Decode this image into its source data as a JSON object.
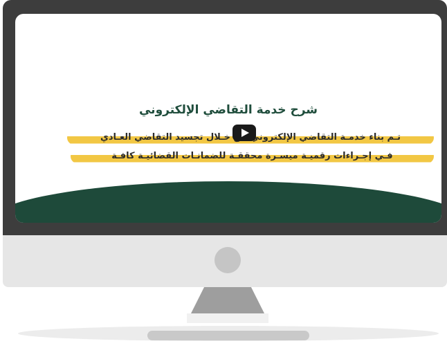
{
  "video": {
    "title": "شرح خدمة التقاضي الإلكتروني",
    "line_1": "تـم بناء خدمـة التقاضي الإلكتروني من خـلال تجسيد التقاضي العـادي",
    "line_2": "فـي إجـراءات رقميـة ميسـرة محققـة للضمانـات القضائيـة كافـة"
  },
  "colors": {
    "bezel": "#3d3d3d",
    "title_green": "#1f4d3c",
    "highlight_yellow": "#f2c744",
    "wave_green": "#1e4a3a",
    "play_button": "#1a1a1a"
  },
  "icons": {
    "play": "play-icon"
  }
}
